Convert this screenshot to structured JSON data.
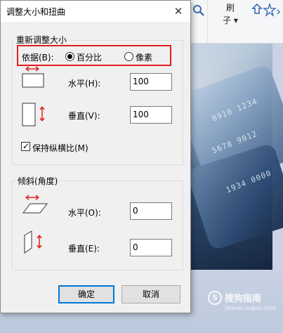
{
  "dialog": {
    "title": "调整大小和扭曲",
    "close_glyph": "✕",
    "resize_group": {
      "label": "重新调整大小",
      "basis_label": "依据(B):",
      "option_percent": "百分比",
      "option_pixel": "像素",
      "selected": "percent",
      "horizontal_label": "水平(H):",
      "horizontal_value": "100",
      "vertical_label": "垂直(V):",
      "vertical_value": "100",
      "keep_ratio_label": "保持纵横比(M)",
      "keep_ratio_checked": true
    },
    "skew_group": {
      "label": "倾斜(角度)",
      "horizontal_label": "水平(O):",
      "horizontal_value": "0",
      "vertical_label": "垂直(E):",
      "vertical_value": "0"
    },
    "ok_label": "确定",
    "cancel_label": "取消"
  },
  "background_app": {
    "brush_top": "刷",
    "brush_bottom": "子",
    "brush_dropdown": "▾",
    "magnifier_icon": "magnifier-icon",
    "shapes_icons": "shapes-icon",
    "card_digits": [
      "8910 1234",
      "5678 9012",
      "1934 0000"
    ],
    "watermark_text": "搜狗指南",
    "watermark_url": "zhinan.sogou.com"
  },
  "colors": {
    "highlight_box": "#e0201d",
    "default_button_border": "#0078d7",
    "icon_red": "#e0201d"
  }
}
